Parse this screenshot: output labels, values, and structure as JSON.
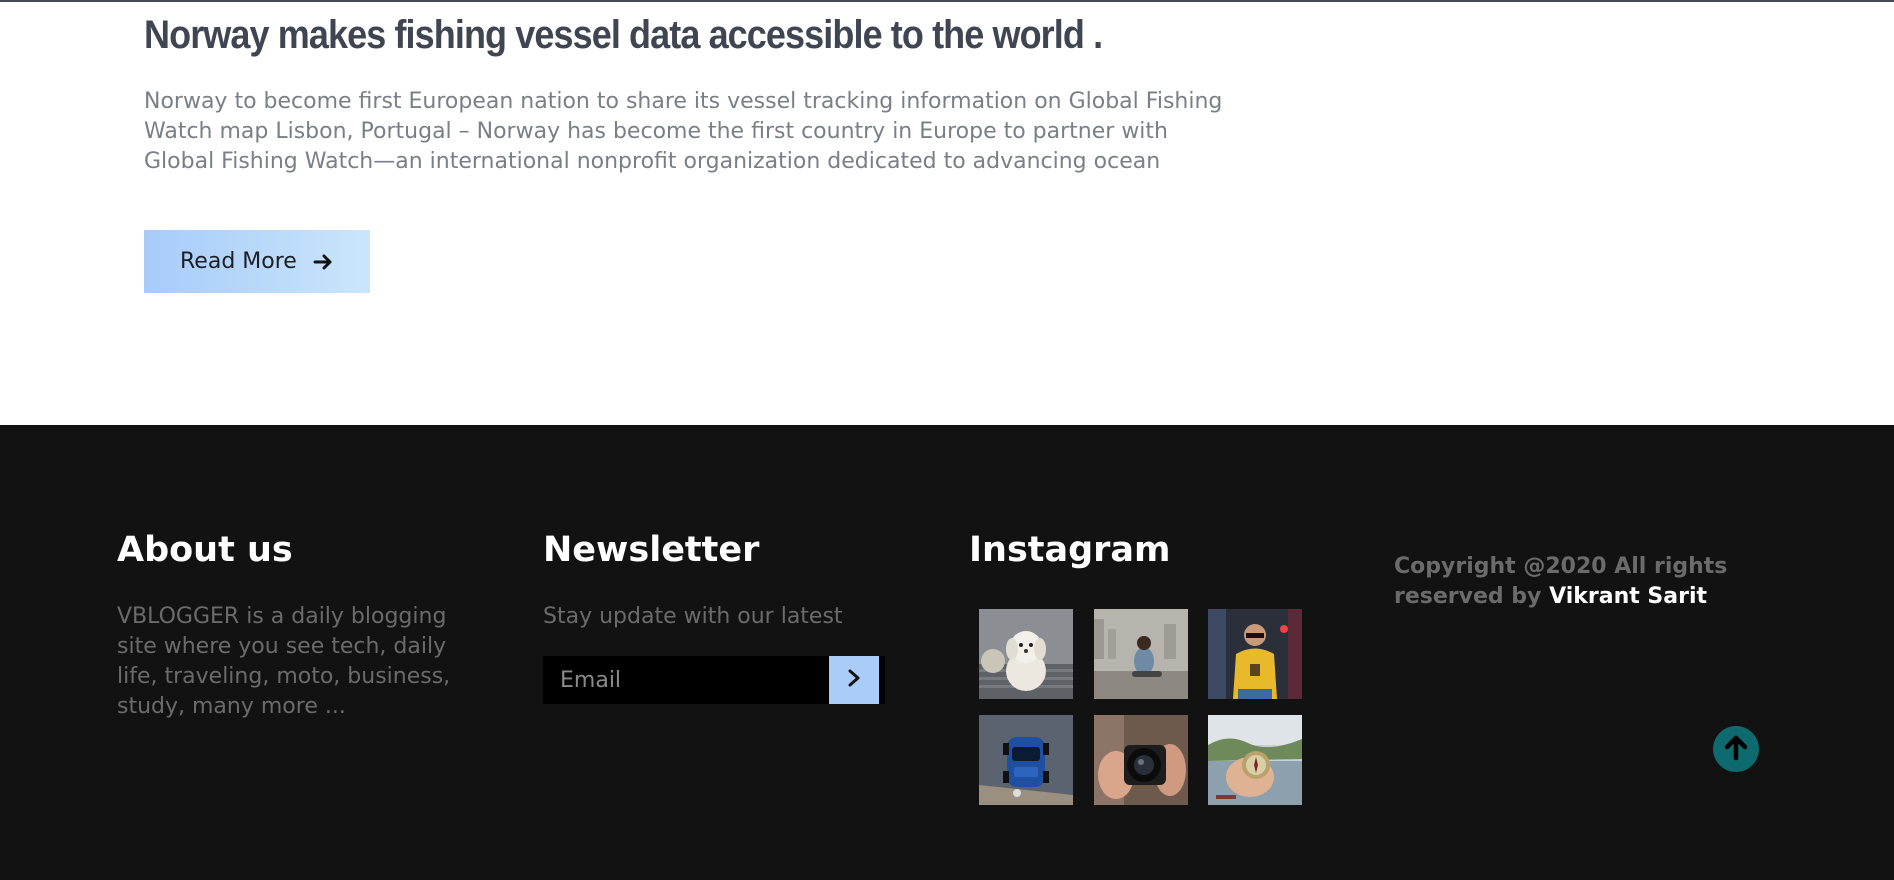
{
  "article": {
    "title": "Norway makes fishing vessel data accessible to the world .",
    "excerpt": "Norway to become first European nation to share its vessel tracking information on Global Fishing Watch map Lisbon, Portugal – Norway has become the first country in Europe to partner with Global Fishing Watch—an international nonprofit organization dedicated to advancing ocean",
    "read_more_label": "Read More",
    "read_more_icon": "arrow-right-icon"
  },
  "footer": {
    "about": {
      "heading": "About us",
      "text": "VBLOGGER is a daily blogging site where you see tech, daily life, traveling, moto, business, study, many more ..."
    },
    "newsletter": {
      "heading": "Newsletter",
      "text": "Stay update with our latest",
      "email_placeholder": "Email",
      "submit_icon": "chevron-right-icon"
    },
    "instagram": {
      "heading": "Instagram",
      "photos": [
        "white-puppy-on-couch",
        "woman-sitting-city-view",
        "man-in-yellow-sweater",
        "blue-car-top-view",
        "hands-holding-camera",
        "hand-holding-compass"
      ]
    },
    "copyright": {
      "prefix": "Copyright @2020 All rights reserved by ",
      "author": "Vikrant Sarit"
    },
    "back_to_top_icon": "arrow-up-circle-icon"
  },
  "colors": {
    "footer_bg": "#121212",
    "button_gradient_start": "#a8cbf9",
    "button_gradient_end": "#c9e6fb",
    "title_text": "#3f4651",
    "body_text": "#7a7f87",
    "footer_muted_text": "#6b6b6b",
    "back_to_top": "#0d6b6f"
  }
}
